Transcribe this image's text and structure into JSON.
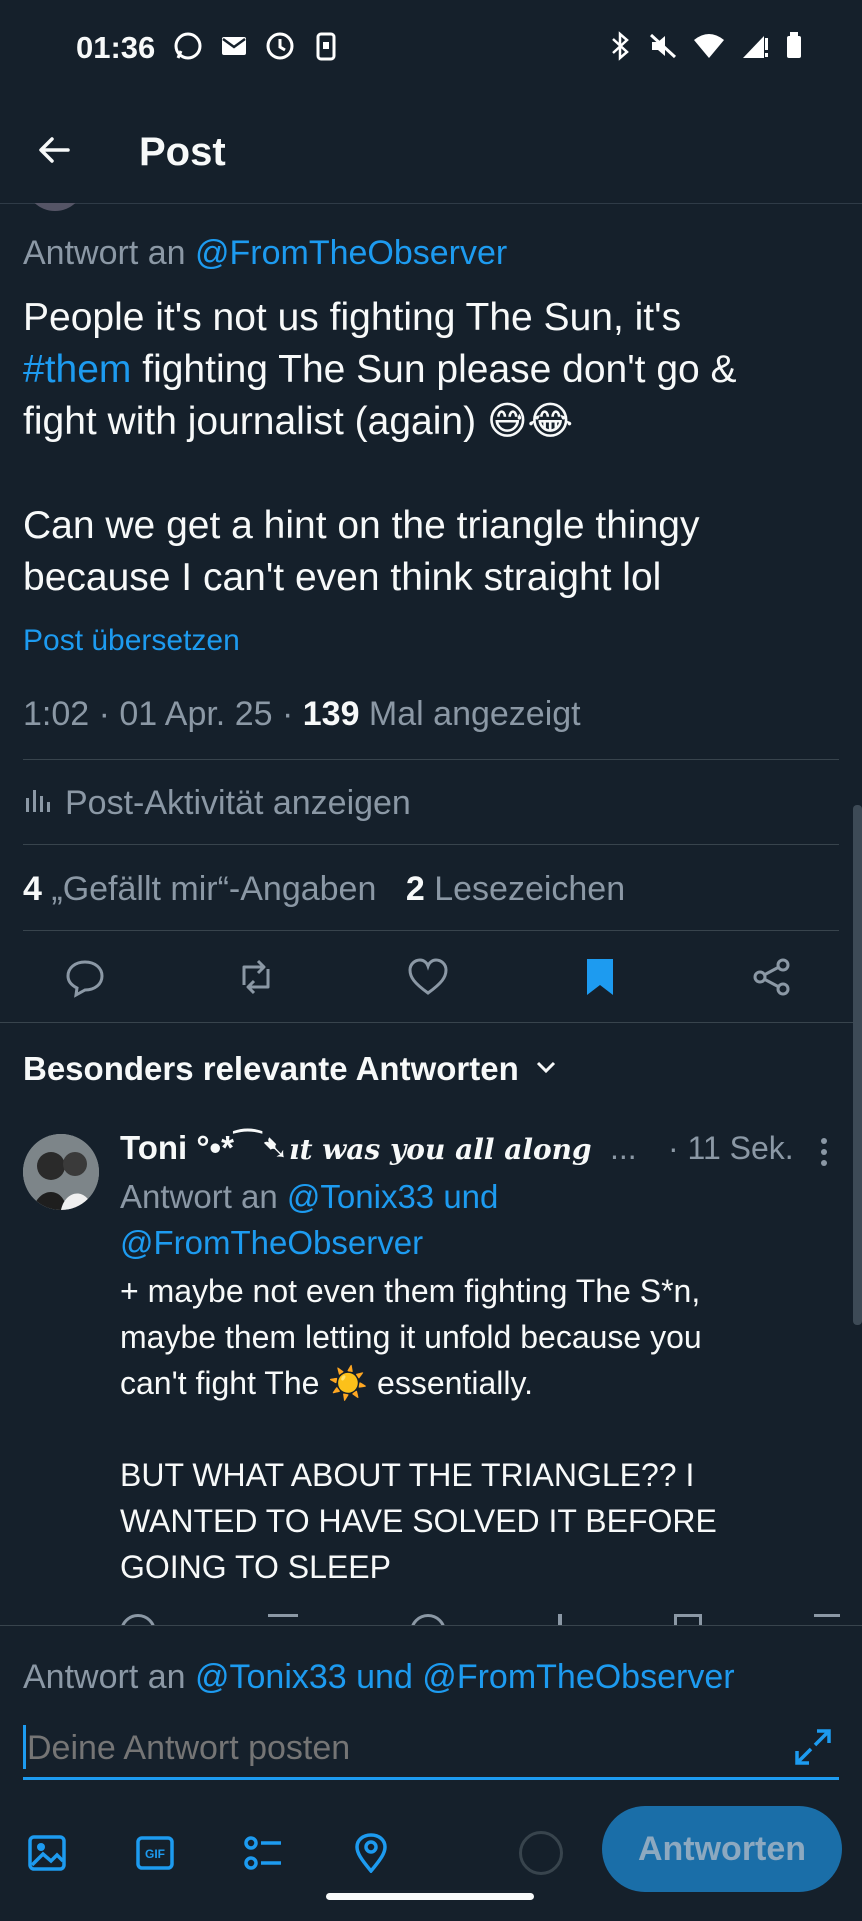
{
  "status_bar": {
    "time": "01:36"
  },
  "header": {
    "title": "Post"
  },
  "post": {
    "reply_to_prefix": "Antwort an",
    "reply_to_handle": "@FromTheObserver",
    "text_line1": "People it's not us fighting The Sun, it's",
    "hashtag": "#them",
    "text_line2_rest": " fighting The Sun please don't go &",
    "text_line3": "fight with journalist (again) 😅😂",
    "text_line4": "Can we get a hint on the triangle thingy",
    "text_line5": "because I can't even think straight lol",
    "translate": "Post übersetzen",
    "meta_prefix": "1:02 · 01 Apr. 25 · ",
    "views_count": "139",
    "views_label": " Mal angezeigt",
    "activity": "Post-Aktivität anzeigen",
    "likes_count": "4",
    "likes_label": " „Gefällt mir“-Angaben",
    "bookmarks_count": "2",
    "bookmarks_label": " Lesezeichen"
  },
  "replies_header": "Besonders relevante Antworten",
  "reply": {
    "name": "Toni °•*⁀➷",
    "name_fancy": "ıt was you all along",
    "ellipsis": "...",
    "time": "· 11 Sek.",
    "reply_prefix": "Antwort an",
    "reply_handles_1": "@Tonix33 und",
    "reply_handles_2": "@FromTheObserver",
    "line1": "+ maybe not even them fighting The S*n,",
    "line2": "maybe them letting it unfold because you",
    "line3": "can't fight The ☀️ essentially.",
    "line4": "BUT WHAT ABOUT THE TRIANGLE?? I",
    "line5": "WANTED TO HAVE SOLVED IT BEFORE",
    "line6": "GOING TO SLEEP"
  },
  "composer": {
    "reply_prefix": "Antwort an",
    "reply_handles": "@Tonix33 und @FromTheObserver",
    "placeholder": "Deine Antwort posten",
    "submit": "Antworten"
  },
  "colors": {
    "background": "#15202b",
    "accent": "#1d9bf0",
    "muted": "#8b98a5"
  }
}
